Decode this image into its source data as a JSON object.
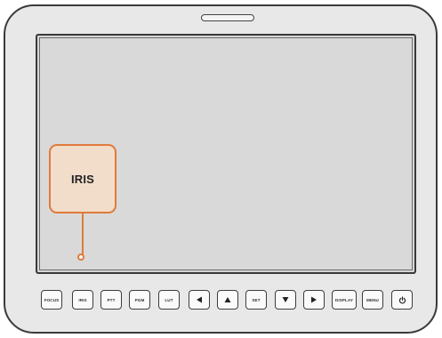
{
  "callout": {
    "label": "IRIS"
  },
  "buttons": [
    {
      "name": "focus-button",
      "label": "FOCUS"
    },
    {
      "name": "iris-button",
      "label": "IRIS"
    },
    {
      "name": "ptt-button",
      "label": "PTT"
    },
    {
      "name": "pgm-button",
      "label": "PGM"
    },
    {
      "name": "lut-button",
      "label": "LUT"
    },
    {
      "name": "left-arrow-button",
      "icon": "triangle-left-icon"
    },
    {
      "name": "up-arrow-button",
      "icon": "triangle-up-icon"
    },
    {
      "name": "set-button",
      "label": "SET"
    },
    {
      "name": "down-arrow-button",
      "icon": "triangle-down-icon"
    },
    {
      "name": "right-arrow-button",
      "icon": "triangle-right-icon"
    },
    {
      "name": "display-button",
      "label": "DISPLAY"
    },
    {
      "name": "menu-button",
      "label": "MENU"
    },
    {
      "name": "power-button",
      "icon": "power-icon"
    }
  ],
  "colors": {
    "callout_accent": "#e07a3b",
    "callout_fill": "#f2ddcb",
    "outline": "#3a3a3a"
  }
}
